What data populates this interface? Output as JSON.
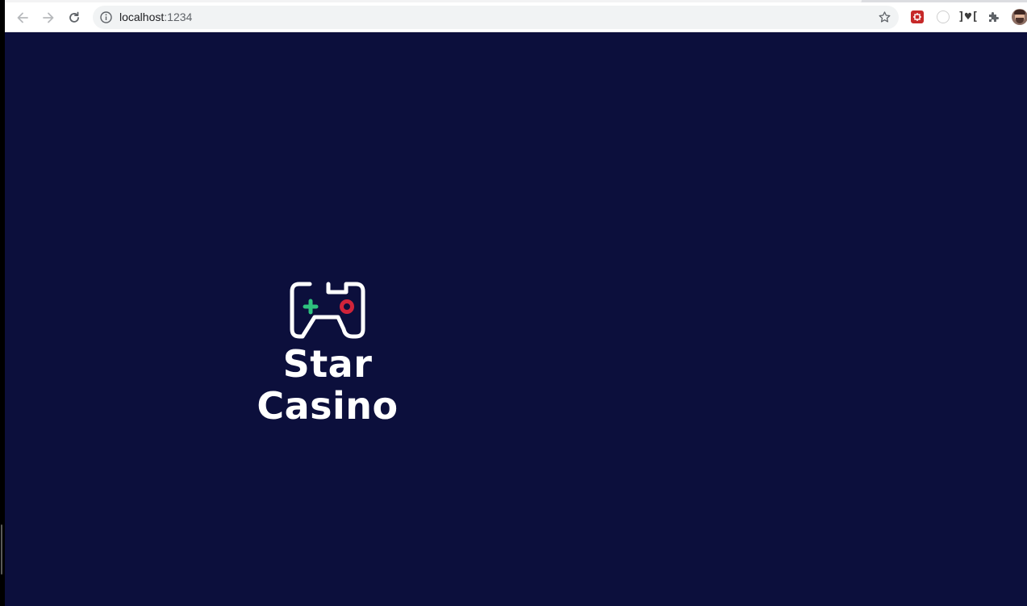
{
  "browser": {
    "url_host": "localhost",
    "url_port": ":1234"
  },
  "page": {
    "background": "#0c0f3c",
    "brand_line1": "Star",
    "brand_line2": "Casino",
    "logo": {
      "icon": "gamepad-icon",
      "dpad_color": "#2ec27e",
      "button_color": "#d0243a"
    }
  }
}
